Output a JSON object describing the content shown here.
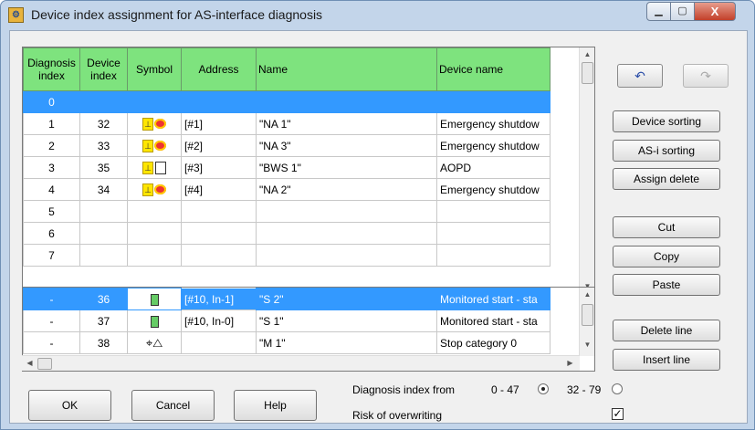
{
  "window": {
    "title": "Device index assignment for AS-interface diagnosis",
    "min_glyph": "▁",
    "max_glyph": "▢",
    "close_glyph": "X"
  },
  "columns": [
    "Diagnosis index",
    "Device index",
    "Symbol",
    "Address",
    "Name",
    "Device name"
  ],
  "top_rows": [
    {
      "diag": "0",
      "dev": "",
      "addr": "",
      "name": "",
      "devname": "",
      "symbol": "",
      "selected": true
    },
    {
      "diag": "1",
      "dev": "32",
      "addr": "[#1]",
      "name": "\"NA 1\"",
      "devname": "Emergency shutdow",
      "symbol": "estop"
    },
    {
      "diag": "2",
      "dev": "33",
      "addr": "[#2]",
      "name": "\"NA 3\"",
      "devname": "Emergency shutdow",
      "symbol": "estop"
    },
    {
      "diag": "3",
      "dev": "35",
      "addr": "[#3]",
      "name": "\"BWS 1\"",
      "devname": "AOPD",
      "symbol": "aopd"
    },
    {
      "diag": "4",
      "dev": "34",
      "addr": "[#4]",
      "name": "\"NA 2\"",
      "devname": "Emergency shutdow",
      "symbol": "estop"
    },
    {
      "diag": "5",
      "dev": "",
      "addr": "",
      "name": "",
      "devname": "",
      "symbol": ""
    },
    {
      "diag": "6",
      "dev": "",
      "addr": "",
      "name": "",
      "devname": "",
      "symbol": ""
    },
    {
      "diag": "7",
      "dev": "",
      "addr": "",
      "name": "",
      "devname": "",
      "symbol": ""
    }
  ],
  "bottom_rows": [
    {
      "diag": "-",
      "dev": "36",
      "addr": "[#10, In-1]",
      "name": "\"S 2\"",
      "devname": "Monitored start - sta",
      "symbol": "start",
      "selected": true
    },
    {
      "diag": "-",
      "dev": "37",
      "addr": "[#10, In-0]",
      "name": "\"S 1\"",
      "devname": "Monitored start - sta",
      "symbol": "start"
    },
    {
      "diag": "-",
      "dev": "38",
      "addr": "",
      "name": "\"M 1\"",
      "devname": "Stop category 0",
      "symbol": "stop"
    }
  ],
  "side_buttons": {
    "undo_icon": "↶",
    "redo_icon": "↷",
    "device_sorting": "Device sorting",
    "asi_sorting": "AS-i sorting",
    "assign_delete": "Assign delete",
    "cut": "Cut",
    "copy": "Copy",
    "paste": "Paste",
    "delete_line": "Delete line",
    "insert_line": "Insert line"
  },
  "footer": {
    "ok": "OK",
    "cancel": "Cancel",
    "help": "Help",
    "diag_index_from_label": "Diagnosis index from",
    "range_1": "0 - 47",
    "range_2": "32 - 79",
    "range_selected": "0 - 47",
    "risk_label": "Risk of overwriting",
    "risk_checked": true,
    "check_glyph": "✓"
  }
}
